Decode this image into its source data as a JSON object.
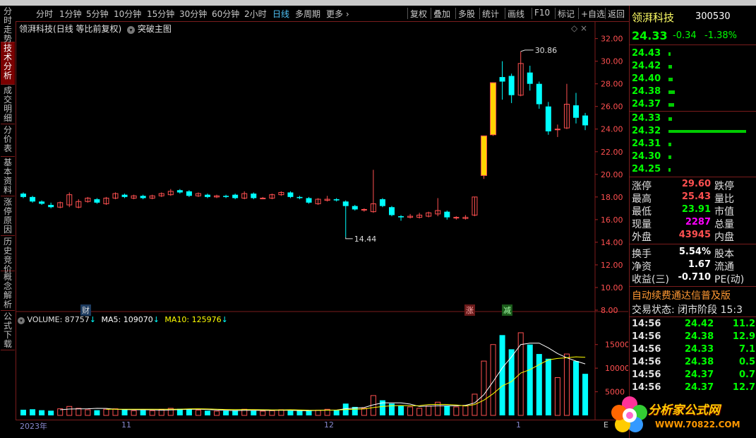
{
  "colors": {
    "up": "#ff5050",
    "down": "#00ffff",
    "limitup": "#ffd400",
    "ma5": "#ffffff",
    "ma10": "#ffff00",
    "border": "#7a1c1c",
    "accent": "#4fc3f7"
  },
  "left_tabs": [
    {
      "label": "分时走势",
      "active": false
    },
    {
      "label": "技术分析",
      "active": true
    },
    {
      "label": "成交明细",
      "active": false
    },
    {
      "label": "分价表",
      "active": false
    },
    {
      "label": "基本资料",
      "active": false
    },
    {
      "label": "涨停原因",
      "active": false
    },
    {
      "label": "历史竞价",
      "active": false
    },
    {
      "label": "概念解析",
      "active": false
    },
    {
      "label": "公式下载",
      "active": false
    }
  ],
  "period_bar": {
    "items": [
      "分时",
      "1分钟",
      "5分钟",
      "10分钟",
      "15分钟",
      "30分钟",
      "60分钟",
      "2小时",
      "日线",
      "多周期",
      "更多 ›"
    ],
    "active": "日线",
    "right_items": [
      "复权",
      "叠加",
      "多股",
      "统计",
      "画线",
      "F10",
      "标记",
      "+自选",
      "返回"
    ]
  },
  "chart_title": {
    "name": "领湃科技",
    "mode": "(日线 等比前复权)",
    "main_figure": "突破主图",
    "sym": "◇"
  },
  "annotations": {
    "high": "30.86",
    "low": "14.44"
  },
  "markers": {
    "cai": "财",
    "zhang": "涨",
    "jian": "减"
  },
  "volume_header": {
    "vol_label": "VOLUME: 87757",
    "ma5_label": "MA5: 109070",
    "ma10_label": "MA10: 125976",
    "arrow": "↓"
  },
  "bottom_dates": {
    "d1": "2023年",
    "d2": "11",
    "d3": "12",
    "d4": "1",
    "d5": "E"
  },
  "right_panel": {
    "stock_name": "领湃科技",
    "stock_code": "300530",
    "price": "24.33",
    "change": "-0.34",
    "change_pct": "-1.38%",
    "sell_book": [
      {
        "p": "24.43"
      },
      {
        "p": "24.42"
      },
      {
        "p": "24.40"
      },
      {
        "p": "24.38"
      },
      {
        "p": "24.37"
      }
    ],
    "buy_book": [
      {
        "p": "24.33"
      },
      {
        "p": "24.32"
      },
      {
        "p": "24.31"
      },
      {
        "p": "24.30"
      },
      {
        "p": "24.25"
      }
    ],
    "stats": [
      {
        "l": "涨停",
        "v": "29.60",
        "r": "跌停",
        "c": "#ff5050"
      },
      {
        "l": "最高",
        "v": "25.43",
        "r": "量比",
        "c": "#ff5050"
      },
      {
        "l": "最低",
        "v": "23.91",
        "r": "市值",
        "c": "#00ff00"
      },
      {
        "l": "现量",
        "v": "2287",
        "r": "总量",
        "c": "#ff00ff"
      },
      {
        "l": "外盘",
        "v": "43945",
        "r": "内盘",
        "c": "#ff5050"
      }
    ],
    "stats2": [
      {
        "l": "换手",
        "v": "5.54%",
        "r": "股本"
      },
      {
        "l": "净资",
        "v": "1.67",
        "r": "流通"
      },
      {
        "l": "收益(三)",
        "v": "-0.710",
        "r": "PE(动)"
      }
    ],
    "banner": "自动续费通达信普及版",
    "status_label": "交易状态: 闭市阶段 15:3",
    "ticks": [
      {
        "t": "14:56",
        "p": "24.42",
        "v": "11.2"
      },
      {
        "t": "14:56",
        "p": "24.38",
        "v": "12.9"
      },
      {
        "t": "14:56",
        "p": "24.33",
        "v": "7.1"
      },
      {
        "t": "14:56",
        "p": "24.38",
        "v": "0.5"
      },
      {
        "t": "14:56",
        "p": "24.37",
        "v": "0.7"
      },
      {
        "t": "14:56",
        "p": "24.37",
        "v": "12.7"
      }
    ]
  },
  "logo": {
    "text": "分析家公式网",
    "url": "WWW.70822.COM"
  },
  "chart_data": {
    "type": "candlestick",
    "price_axis": {
      "ticks": [
        "32.00",
        "30.00",
        "28.00",
        "26.00",
        "24.00",
        "22.00",
        "20.00",
        "18.00",
        "16.00",
        "14.00",
        "12.00",
        "10.00",
        "8.00"
      ],
      "range": [
        8,
        32.6
      ]
    },
    "volume_axis": {
      "ticks": [
        "15000",
        "10000",
        "5000"
      ],
      "range": [
        0,
        17500
      ]
    },
    "candles": [
      {
        "o": 18.3,
        "c": 18.0,
        "h": 18.4,
        "l": 17.9
      },
      {
        "o": 18.0,
        "c": 17.6,
        "h": 18.1,
        "l": 17.5
      },
      {
        "o": 17.6,
        "c": 17.4,
        "h": 17.7,
        "l": 17.3
      },
      {
        "o": 17.3,
        "c": 17.1,
        "h": 17.5,
        "l": 17.0
      },
      {
        "o": 17.1,
        "c": 17.5,
        "h": 17.6,
        "l": 17.0
      },
      {
        "o": 17.3,
        "c": 18.2,
        "h": 18.4,
        "l": 17.1
      },
      {
        "o": 17.1,
        "c": 17.6,
        "h": 17.8,
        "l": 17.0
      },
      {
        "o": 17.6,
        "c": 17.9,
        "h": 18.0,
        "l": 17.5
      },
      {
        "o": 17.8,
        "c": 17.5,
        "h": 17.9,
        "l": 17.4
      },
      {
        "o": 17.4,
        "c": 17.9,
        "h": 18.0,
        "l": 17.3
      },
      {
        "o": 17.9,
        "c": 18.3,
        "h": 18.4,
        "l": 17.8
      },
      {
        "o": 18.2,
        "c": 18.0,
        "h": 18.3,
        "l": 17.9
      },
      {
        "o": 17.9,
        "c": 18.1,
        "h": 18.2,
        "l": 17.8
      },
      {
        "o": 18.1,
        "c": 17.9,
        "h": 18.2,
        "l": 17.8
      },
      {
        "o": 17.9,
        "c": 18.1,
        "h": 18.2,
        "l": 17.8
      },
      {
        "o": 18.1,
        "c": 18.3,
        "h": 18.4,
        "l": 18.0
      },
      {
        "o": 18.2,
        "c": 18.5,
        "h": 18.7,
        "l": 18.1
      },
      {
        "o": 18.6,
        "c": 18.4,
        "h": 18.7,
        "l": 18.3
      },
      {
        "o": 18.5,
        "c": 18.1,
        "h": 18.6,
        "l": 18.0
      },
      {
        "o": 18.1,
        "c": 18.3,
        "h": 18.4,
        "l": 18.0
      },
      {
        "o": 18.2,
        "c": 18.0,
        "h": 18.3,
        "l": 17.9
      },
      {
        "o": 18.0,
        "c": 18.1,
        "h": 18.2,
        "l": 17.9
      },
      {
        "o": 18.1,
        "c": 18.0,
        "h": 18.2,
        "l": 17.9
      },
      {
        "o": 18.2,
        "c": 17.9,
        "h": 18.3,
        "l": 17.8
      },
      {
        "o": 17.9,
        "c": 18.3,
        "h": 18.5,
        "l": 17.8
      },
      {
        "o": 18.3,
        "c": 17.9,
        "h": 18.4,
        "l": 17.8
      },
      {
        "o": 17.9,
        "c": 17.9,
        "h": 18.0,
        "l": 17.8
      },
      {
        "o": 17.9,
        "c": 18.2,
        "h": 18.3,
        "l": 17.8
      },
      {
        "o": 18.2,
        "c": 18.4,
        "h": 18.5,
        "l": 18.1
      },
      {
        "o": 18.4,
        "c": 18.0,
        "h": 18.5,
        "l": 17.9
      },
      {
        "o": 18.0,
        "c": 17.9,
        "h": 18.1,
        "l": 17.8
      },
      {
        "o": 17.9,
        "c": 17.5,
        "h": 18.0,
        "l": 17.4
      },
      {
        "o": 17.4,
        "c": 17.8,
        "h": 17.9,
        "l": 17.3
      },
      {
        "o": 17.7,
        "c": 17.8,
        "h": 18.1,
        "l": 17.6
      },
      {
        "o": 17.8,
        "c": 17.7,
        "h": 17.9,
        "l": 17.6
      },
      {
        "o": 17.6,
        "c": 17.2,
        "h": 17.7,
        "l": 14.44
      },
      {
        "o": 17.2,
        "c": 16.9,
        "h": 17.3,
        "l": 16.8
      },
      {
        "o": 16.9,
        "c": 16.9,
        "h": 17.0,
        "l": 16.7
      },
      {
        "o": 16.7,
        "c": 17.4,
        "h": 20.4,
        "l": 16.6
      },
      {
        "o": 17.8,
        "c": 17.2,
        "h": 17.9,
        "l": 17.1
      },
      {
        "o": 17.1,
        "c": 16.4,
        "h": 17.2,
        "l": 16.3
      },
      {
        "o": 16.3,
        "c": 16.2,
        "h": 16.4,
        "l": 15.9
      },
      {
        "o": 16.2,
        "c": 16.3,
        "h": 16.5,
        "l": 16.1
      },
      {
        "o": 16.2,
        "c": 16.4,
        "h": 16.6,
        "l": 16.1
      },
      {
        "o": 16.3,
        "c": 16.6,
        "h": 16.7,
        "l": 16.2
      },
      {
        "o": 16.5,
        "c": 16.8,
        "h": 17.9,
        "l": 16.3
      },
      {
        "o": 16.7,
        "c": 16.2,
        "h": 16.8,
        "l": 16.0
      },
      {
        "o": 16.2,
        "c": 16.2,
        "h": 16.3,
        "l": 16.0
      },
      {
        "o": 16.1,
        "c": 16.2,
        "h": 16.4,
        "l": 16.0
      },
      {
        "o": 16.4,
        "c": 18.0,
        "h": 18.0,
        "l": 16.3
      },
      {
        "o": 19.9,
        "c": 23.4,
        "h": 23.4,
        "l": 19.6
      },
      {
        "o": 23.5,
        "c": 28.1,
        "h": 28.1,
        "l": 23.4
      },
      {
        "o": 28.6,
        "c": 28.2,
        "h": 30.0,
        "l": 26.6
      },
      {
        "o": 28.7,
        "c": 27.0,
        "h": 28.9,
        "l": 26.3
      },
      {
        "o": 27.0,
        "c": 29.8,
        "h": 30.86,
        "l": 26.9
      },
      {
        "o": 29.0,
        "c": 28.0,
        "h": 29.6,
        "l": 27.4
      },
      {
        "o": 28.0,
        "c": 26.2,
        "h": 28.2,
        "l": 25.8
      },
      {
        "o": 26.0,
        "c": 23.8,
        "h": 26.4,
        "l": 23.5
      },
      {
        "o": 24.0,
        "c": 24.0,
        "h": 24.4,
        "l": 23.3
      },
      {
        "o": 24.1,
        "c": 26.2,
        "h": 28.0,
        "l": 24.0
      },
      {
        "o": 26.1,
        "c": 25.0,
        "h": 27.2,
        "l": 24.5
      },
      {
        "o": 25.2,
        "c": 24.33,
        "h": 25.43,
        "l": 23.91
      }
    ],
    "volumes": [
      1200,
      1300,
      1100,
      1000,
      1400,
      1900,
      1500,
      1200,
      1100,
      1300,
      1400,
      1200,
      1000,
      1100,
      1000,
      1200,
      1500,
      1400,
      1300,
      1100,
      1000,
      900,
      1000,
      1100,
      1300,
      1000,
      900,
      1000,
      1200,
      1000,
      1000,
      1000,
      1100,
      1300,
      1200,
      2500,
      1800,
      1500,
      4200,
      3200,
      2500,
      2000,
      1800,
      1500,
      2000,
      2800,
      2100,
      1800,
      2000,
      4500,
      11500,
      15000,
      17000,
      14000,
      17500,
      15000,
      13000,
      12000,
      8000,
      13000,
      11500,
      8800
    ],
    "ma5": [
      null,
      null,
      null,
      null,
      1200,
      1340,
      1380,
      1400,
      1500,
      1480,
      1300,
      1240,
      1200,
      1200,
      1180,
      1100,
      1160,
      1240,
      1280,
      1300,
      1260,
      1140,
      1060,
      1020,
      1060,
      1060,
      1060,
      1060,
      1100,
      1080,
      1020,
      1020,
      1060,
      1120,
      1120,
      1420,
      1560,
      1660,
      2240,
      2640,
      2640,
      2640,
      2400,
      1900,
      1960,
      2020,
      2040,
      2040,
      2140,
      2640,
      4380,
      7160,
      10060,
      12400,
      15000,
      15300,
      15300,
      14300,
      13100,
      12200,
      11500,
      10900
    ],
    "ma10": [
      null,
      null,
      null,
      null,
      null,
      null,
      null,
      null,
      null,
      1300,
      1310,
      1310,
      1300,
      1310,
      1310,
      1300,
      1300,
      1320,
      1380,
      1400,
      1360,
      1300,
      1260,
      1240,
      1240,
      1220,
      1200,
      1160,
      1170,
      1200,
      1160,
      1100,
      1090,
      1110,
      1120,
      1220,
      1300,
      1360,
      1660,
      1880,
      2030,
      2100,
      2030,
      2070,
      2300,
      2330,
      2320,
      2210,
      2000,
      2300,
      3230,
      4590,
      6230,
      7170,
      8980,
      9690,
      10760,
      11760,
      12060,
      12200,
      12400,
      12300
    ]
  }
}
